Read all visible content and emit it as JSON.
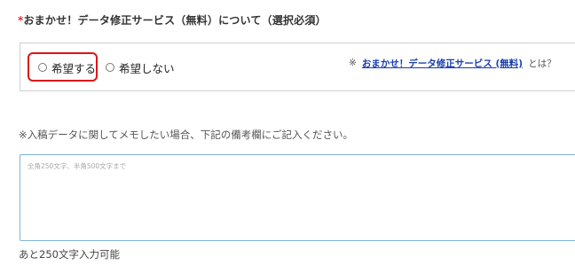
{
  "section": {
    "required_mark": "*",
    "heading": "おまかせ！データ修正サービス（無料）について（選択必須）"
  },
  "options": {
    "yes_label": "希望する",
    "no_label": "希望しない"
  },
  "note": {
    "mark": "※",
    "link_text": "おまかせ！データ修正サービス (無料)",
    "suffix": "とは？"
  },
  "memo": {
    "label": "※入稿データに関してメモしたい場合、下記の備考欄にご記入ください。",
    "placeholder": "全角250文字、半角500文字まで",
    "char_count": "あと250文字入力可能"
  },
  "colors": {
    "highlight": "#e0121a",
    "link": "#1a3fb0",
    "required": "#d9323f",
    "input_border": "#7fb3d9"
  }
}
